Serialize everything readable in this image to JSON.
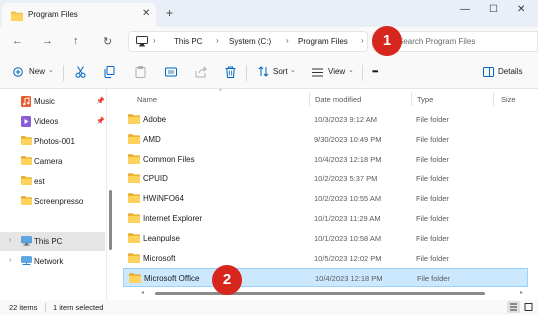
{
  "window": {
    "tab_title": "Program Files",
    "tab_close": "✕",
    "new_tab": "+",
    "minimize": "—",
    "maximize": "☐",
    "close": "✕"
  },
  "nav": {
    "back": "←",
    "forward": "→",
    "up": "↑",
    "refresh": "↻",
    "breadcrumb": [
      "This PC",
      "System (C:)",
      "Program Files"
    ],
    "search_placeholder": "Search Program Files"
  },
  "toolbar": {
    "new_label": "New",
    "sort_label": "Sort",
    "view_label": "View",
    "more_label": "•••",
    "details_label": "Details"
  },
  "sidebar": {
    "items": [
      {
        "label": "Music",
        "icon": "music-icon",
        "pinned": true
      },
      {
        "label": "Videos",
        "icon": "videos-icon",
        "pinned": true
      },
      {
        "label": "Photos-001",
        "icon": "folder-icon",
        "pinned": false
      },
      {
        "label": "Camera",
        "icon": "folder-icon",
        "pinned": false
      },
      {
        "label": "est",
        "icon": "folder-icon",
        "pinned": false
      },
      {
        "label": "Screenpresso",
        "icon": "folder-icon",
        "pinned": false
      }
    ],
    "tree": [
      {
        "label": "This PC",
        "icon": "this-pc-icon",
        "selected": true
      },
      {
        "label": "Network",
        "icon": "network-icon",
        "selected": false
      }
    ]
  },
  "columns": {
    "name": "Name",
    "date": "Date modified",
    "type": "Type",
    "size": "Size"
  },
  "files": [
    {
      "name": "Adobe",
      "date": "10/3/2023 9:12 AM",
      "type": "File folder"
    },
    {
      "name": "AMD",
      "date": "9/30/2023 10:49 PM",
      "type": "File folder"
    },
    {
      "name": "Common Files",
      "date": "10/4/2023 12:18 PM",
      "type": "File folder"
    },
    {
      "name": "CPUID",
      "date": "10/2/2023 5:37 PM",
      "type": "File folder"
    },
    {
      "name": "HWiNFO64",
      "date": "10/2/2023 10:55 AM",
      "type": "File folder"
    },
    {
      "name": "Internet Explorer",
      "date": "10/1/2023 11:29 AM",
      "type": "File folder"
    },
    {
      "name": "Leanpulse",
      "date": "10/1/2023 10:58 AM",
      "type": "File folder"
    },
    {
      "name": "Microsoft",
      "date": "10/5/2023 12:02 PM",
      "type": "File folder"
    },
    {
      "name": "Microsoft Office",
      "date": "10/4/2023 12:18 PM",
      "type": "File folder"
    }
  ],
  "status": {
    "items_count": "22 items",
    "selected": "1 item selected"
  },
  "callouts": [
    "1",
    "2"
  ],
  "colors": {
    "callout": "#d7261e",
    "selection": "#cce8ff",
    "folder": "#f4c24f",
    "accent": "#0067c0"
  }
}
